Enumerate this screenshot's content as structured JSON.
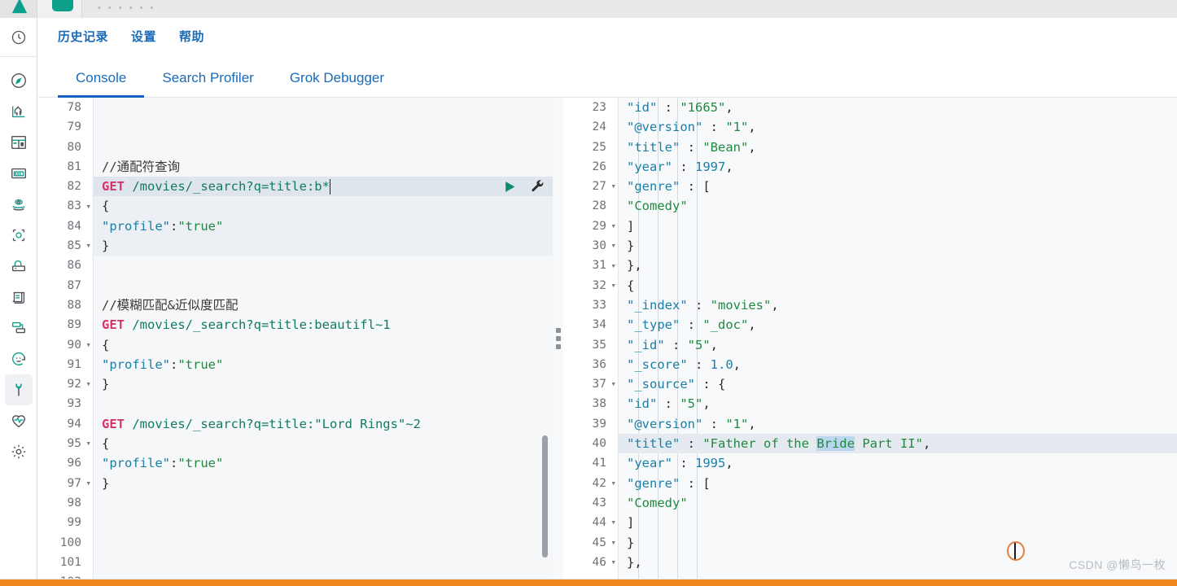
{
  "window": {
    "top_dots": "• • • • • •"
  },
  "sidebar": {
    "items": [
      {
        "name": "recently-viewed-icon",
        "label": "Recently viewed"
      },
      {
        "name": "discover-icon",
        "label": "Discover"
      },
      {
        "name": "visualize-icon",
        "label": "Visualize"
      },
      {
        "name": "dashboard-icon",
        "label": "Dashboard"
      },
      {
        "name": "canvas-icon",
        "label": "Canvas"
      },
      {
        "name": "maps-icon",
        "label": "Maps"
      },
      {
        "name": "machine-learning-icon",
        "label": "Machine Learning"
      },
      {
        "name": "infrastructure-icon",
        "label": "Infrastructure"
      },
      {
        "name": "logs-icon",
        "label": "Logs"
      },
      {
        "name": "apm-icon",
        "label": "APM"
      },
      {
        "name": "uptime-icon",
        "label": "Uptime"
      },
      {
        "name": "dev-tools-icon",
        "label": "Dev Tools"
      },
      {
        "name": "monitoring-icon",
        "label": "Monitoring"
      },
      {
        "name": "management-icon",
        "label": "Management"
      }
    ],
    "active_index": 11
  },
  "toplinks": [
    {
      "label": "历史记录",
      "name": "history-link"
    },
    {
      "label": "设置",
      "name": "settings-link"
    },
    {
      "label": "帮助",
      "name": "help-link"
    }
  ],
  "tabs": [
    {
      "label": "Console",
      "name": "tab-console",
      "active": true
    },
    {
      "label": "Search Profiler",
      "name": "tab-search-profiler",
      "active": false
    },
    {
      "label": "Grok Debugger",
      "name": "tab-grok-debugger",
      "active": false
    }
  ],
  "editor": {
    "first_visible_line": 78,
    "lines": [
      {
        "n": "78",
        "text": "",
        "fold": false,
        "error": false
      },
      {
        "n": "79",
        "text": "",
        "fold": false,
        "error": false
      },
      {
        "n": "80",
        "text": "",
        "fold": false,
        "error": false
      },
      {
        "n": "81",
        "text": "//通配符查询",
        "fold": false,
        "error": true,
        "kind": "comment"
      },
      {
        "n": "82",
        "text": "GET /movies/_search?q=title:b*",
        "fold": false,
        "error": false,
        "kind": "request",
        "current": true
      },
      {
        "n": "83",
        "text": "{",
        "fold": true,
        "error": false,
        "kind": "punc"
      },
      {
        "n": "84",
        "text": "  \"profile\":\"true\"",
        "fold": false,
        "error": false,
        "kind": "kv"
      },
      {
        "n": "85",
        "text": "}",
        "fold": true,
        "error": false,
        "kind": "punc"
      },
      {
        "n": "86",
        "text": "",
        "fold": false,
        "error": false
      },
      {
        "n": "87",
        "text": "",
        "fold": false,
        "error": false
      },
      {
        "n": "88",
        "text": "//模糊匹配&近似度匹配",
        "fold": false,
        "error": true,
        "kind": "comment"
      },
      {
        "n": "89",
        "text": "GET /movies/_search?q=title:beautifl~1",
        "fold": false,
        "error": false,
        "kind": "request"
      },
      {
        "n": "90",
        "text": "{",
        "fold": true,
        "error": false,
        "kind": "punc"
      },
      {
        "n": "91",
        "text": "  \"profile\":\"true\"",
        "fold": false,
        "error": false,
        "kind": "kv"
      },
      {
        "n": "92",
        "text": "}",
        "fold": true,
        "error": false,
        "kind": "punc"
      },
      {
        "n": "93",
        "text": "",
        "fold": false,
        "error": false
      },
      {
        "n": "94",
        "text": "GET /movies/_search?q=title:\"Lord Rings\"~2",
        "fold": false,
        "error": false,
        "kind": "request"
      },
      {
        "n": "95",
        "text": "{",
        "fold": true,
        "error": false,
        "kind": "punc"
      },
      {
        "n": "96",
        "text": "  \"profile\":\"true\"",
        "fold": false,
        "error": false,
        "kind": "kv"
      },
      {
        "n": "97",
        "text": "}",
        "fold": true,
        "error": false,
        "kind": "punc"
      },
      {
        "n": "98",
        "text": "",
        "fold": false,
        "error": false
      },
      {
        "n": "99",
        "text": "",
        "fold": false,
        "error": false
      },
      {
        "n": "100",
        "text": "",
        "fold": false,
        "error": false
      },
      {
        "n": "101",
        "text": "",
        "fold": false,
        "error": false
      },
      {
        "n": "102",
        "text": "",
        "fold": false,
        "error": false
      }
    ],
    "request_line_label": "GET",
    "request_path": " /movies/_search?q=title:b*",
    "play_title": "Click to send request",
    "wrench_title": "Open documentation"
  },
  "response": {
    "lines": [
      {
        "n": "23",
        "indent": 4,
        "fold": false,
        "key": "\"id\"",
        "sep": " : ",
        "val": "\"1665\"",
        "valtype": "str",
        "tail": ","
      },
      {
        "n": "24",
        "indent": 4,
        "fold": false,
        "key": "\"@version\"",
        "sep": " : ",
        "val": "\"1\"",
        "valtype": "str",
        "tail": ","
      },
      {
        "n": "25",
        "indent": 4,
        "fold": false,
        "key": "\"title\"",
        "sep": " : ",
        "val": "\"Bean\"",
        "valtype": "str",
        "tail": ","
      },
      {
        "n": "26",
        "indent": 4,
        "fold": false,
        "key": "\"year\"",
        "sep": " : ",
        "val": "1997",
        "valtype": "num",
        "tail": ","
      },
      {
        "n": "27",
        "indent": 4,
        "fold": true,
        "key": "\"genre\"",
        "sep": " : ",
        "val": "[",
        "valtype": "punc",
        "tail": ""
      },
      {
        "n": "28",
        "indent": 5,
        "fold": false,
        "key": "",
        "sep": "",
        "val": "\"Comedy\"",
        "valtype": "str",
        "tail": ""
      },
      {
        "n": "29",
        "indent": 4,
        "fold": true,
        "key": "",
        "sep": "",
        "val": "]",
        "valtype": "punc",
        "tail": ""
      },
      {
        "n": "30",
        "indent": 3,
        "fold": true,
        "key": "",
        "sep": "",
        "val": "}",
        "valtype": "punc",
        "tail": ""
      },
      {
        "n": "31",
        "indent": 2,
        "fold": true,
        "key": "",
        "sep": "",
        "val": "}",
        "valtype": "punc",
        "tail": ","
      },
      {
        "n": "32",
        "indent": 2,
        "fold": true,
        "key": "",
        "sep": "",
        "val": "{",
        "valtype": "punc",
        "tail": ""
      },
      {
        "n": "33",
        "indent": 3,
        "fold": false,
        "key": "\"_index\"",
        "sep": " : ",
        "val": "\"movies\"",
        "valtype": "str",
        "tail": ","
      },
      {
        "n": "34",
        "indent": 3,
        "fold": false,
        "key": "\"_type\"",
        "sep": " : ",
        "val": "\"_doc\"",
        "valtype": "str",
        "tail": ","
      },
      {
        "n": "35",
        "indent": 3,
        "fold": false,
        "key": "\"_id\"",
        "sep": " : ",
        "val": "\"5\"",
        "valtype": "str",
        "tail": ","
      },
      {
        "n": "36",
        "indent": 3,
        "fold": false,
        "key": "\"_score\"",
        "sep": " : ",
        "val": "1.0",
        "valtype": "num",
        "tail": ","
      },
      {
        "n": "37",
        "indent": 3,
        "fold": true,
        "key": "\"_source\"",
        "sep": " : ",
        "val": "{",
        "valtype": "punc",
        "tail": ""
      },
      {
        "n": "38",
        "indent": 4,
        "fold": false,
        "key": "\"id\"",
        "sep": " : ",
        "val": "\"5\"",
        "valtype": "str",
        "tail": ","
      },
      {
        "n": "39",
        "indent": 4,
        "fold": false,
        "key": "\"@version\"",
        "sep": " : ",
        "val": "\"1\"",
        "valtype": "str",
        "tail": ","
      },
      {
        "n": "40",
        "indent": 4,
        "fold": false,
        "key": "\"title\"",
        "sep": " : ",
        "val": "\"Father of the Bride Part II\"",
        "valtype": "str",
        "tail": ",",
        "current": true,
        "selection": "Bride"
      },
      {
        "n": "41",
        "indent": 4,
        "fold": false,
        "key": "\"year\"",
        "sep": " : ",
        "val": "1995",
        "valtype": "num",
        "tail": ","
      },
      {
        "n": "42",
        "indent": 4,
        "fold": true,
        "key": "\"genre\"",
        "sep": " : ",
        "val": "[",
        "valtype": "punc",
        "tail": ""
      },
      {
        "n": "43",
        "indent": 5,
        "fold": false,
        "key": "",
        "sep": "",
        "val": "\"Comedy\"",
        "valtype": "str",
        "tail": ""
      },
      {
        "n": "44",
        "indent": 4,
        "fold": true,
        "key": "",
        "sep": "",
        "val": "]",
        "valtype": "punc",
        "tail": ""
      },
      {
        "n": "45",
        "indent": 3,
        "fold": true,
        "key": "",
        "sep": "",
        "val": "}",
        "valtype": "punc",
        "tail": ""
      },
      {
        "n": "46",
        "indent": 2,
        "fold": true,
        "key": "",
        "sep": "",
        "val": "}",
        "valtype": "punc",
        "tail": ","
      }
    ]
  },
  "watermark": "CSDN @懒鸟一枚",
  "colors": {
    "accent_blue": "#1662c4",
    "link_blue": "#1a6bb8",
    "method_pink": "#d6336c",
    "url_teal": "#117a65",
    "string_green": "#1f8a3e",
    "key_blue": "#1a7fa8",
    "error_red": "#cf4520",
    "play_green": "#0a8a6e",
    "orange_bar": "#f0871e",
    "teal_logo": "#0fa08c"
  }
}
